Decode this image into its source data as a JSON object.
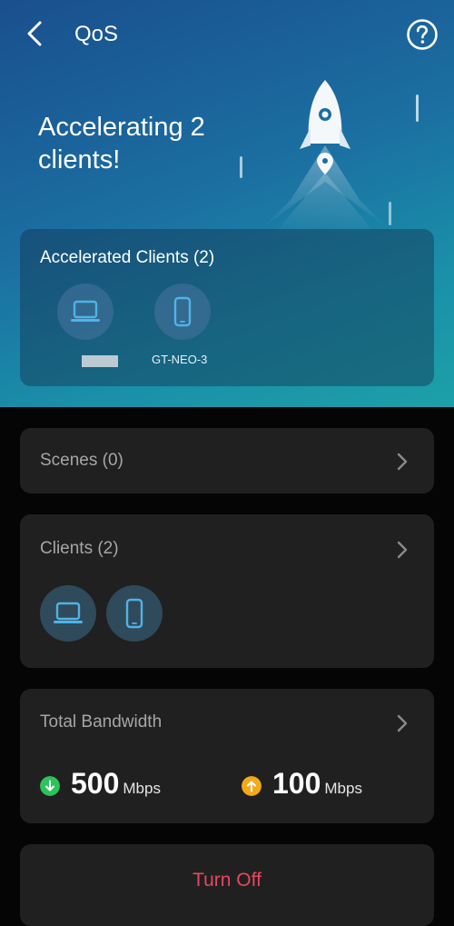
{
  "header": {
    "title": "QoS"
  },
  "hero": {
    "headline": "Accelerating 2 clients!",
    "accelerated_card": {
      "title": "Accelerated Clients (2)",
      "clients": [
        {
          "type": "laptop",
          "label": ""
        },
        {
          "type": "phone",
          "label": "GT-NEO-3"
        }
      ]
    }
  },
  "scenes": {
    "label": "Scenes (0)"
  },
  "clients": {
    "label": "Clients (2)",
    "devices": [
      "laptop",
      "phone"
    ]
  },
  "bandwidth": {
    "label": "Total Bandwidth",
    "download": {
      "value": "500",
      "unit": "Mbps",
      "color": "#2bc35a"
    },
    "upload": {
      "value": "100",
      "unit": "Mbps",
      "color": "#f2a91a"
    }
  },
  "action": {
    "turn_off_label": "Turn Off",
    "color": "#e8475f"
  },
  "colors": {
    "hero_top": "#1a4f8e",
    "hero_bottom": "#1da0a8",
    "card_bg": "#202021",
    "device_icon": "#4fb3e8"
  }
}
